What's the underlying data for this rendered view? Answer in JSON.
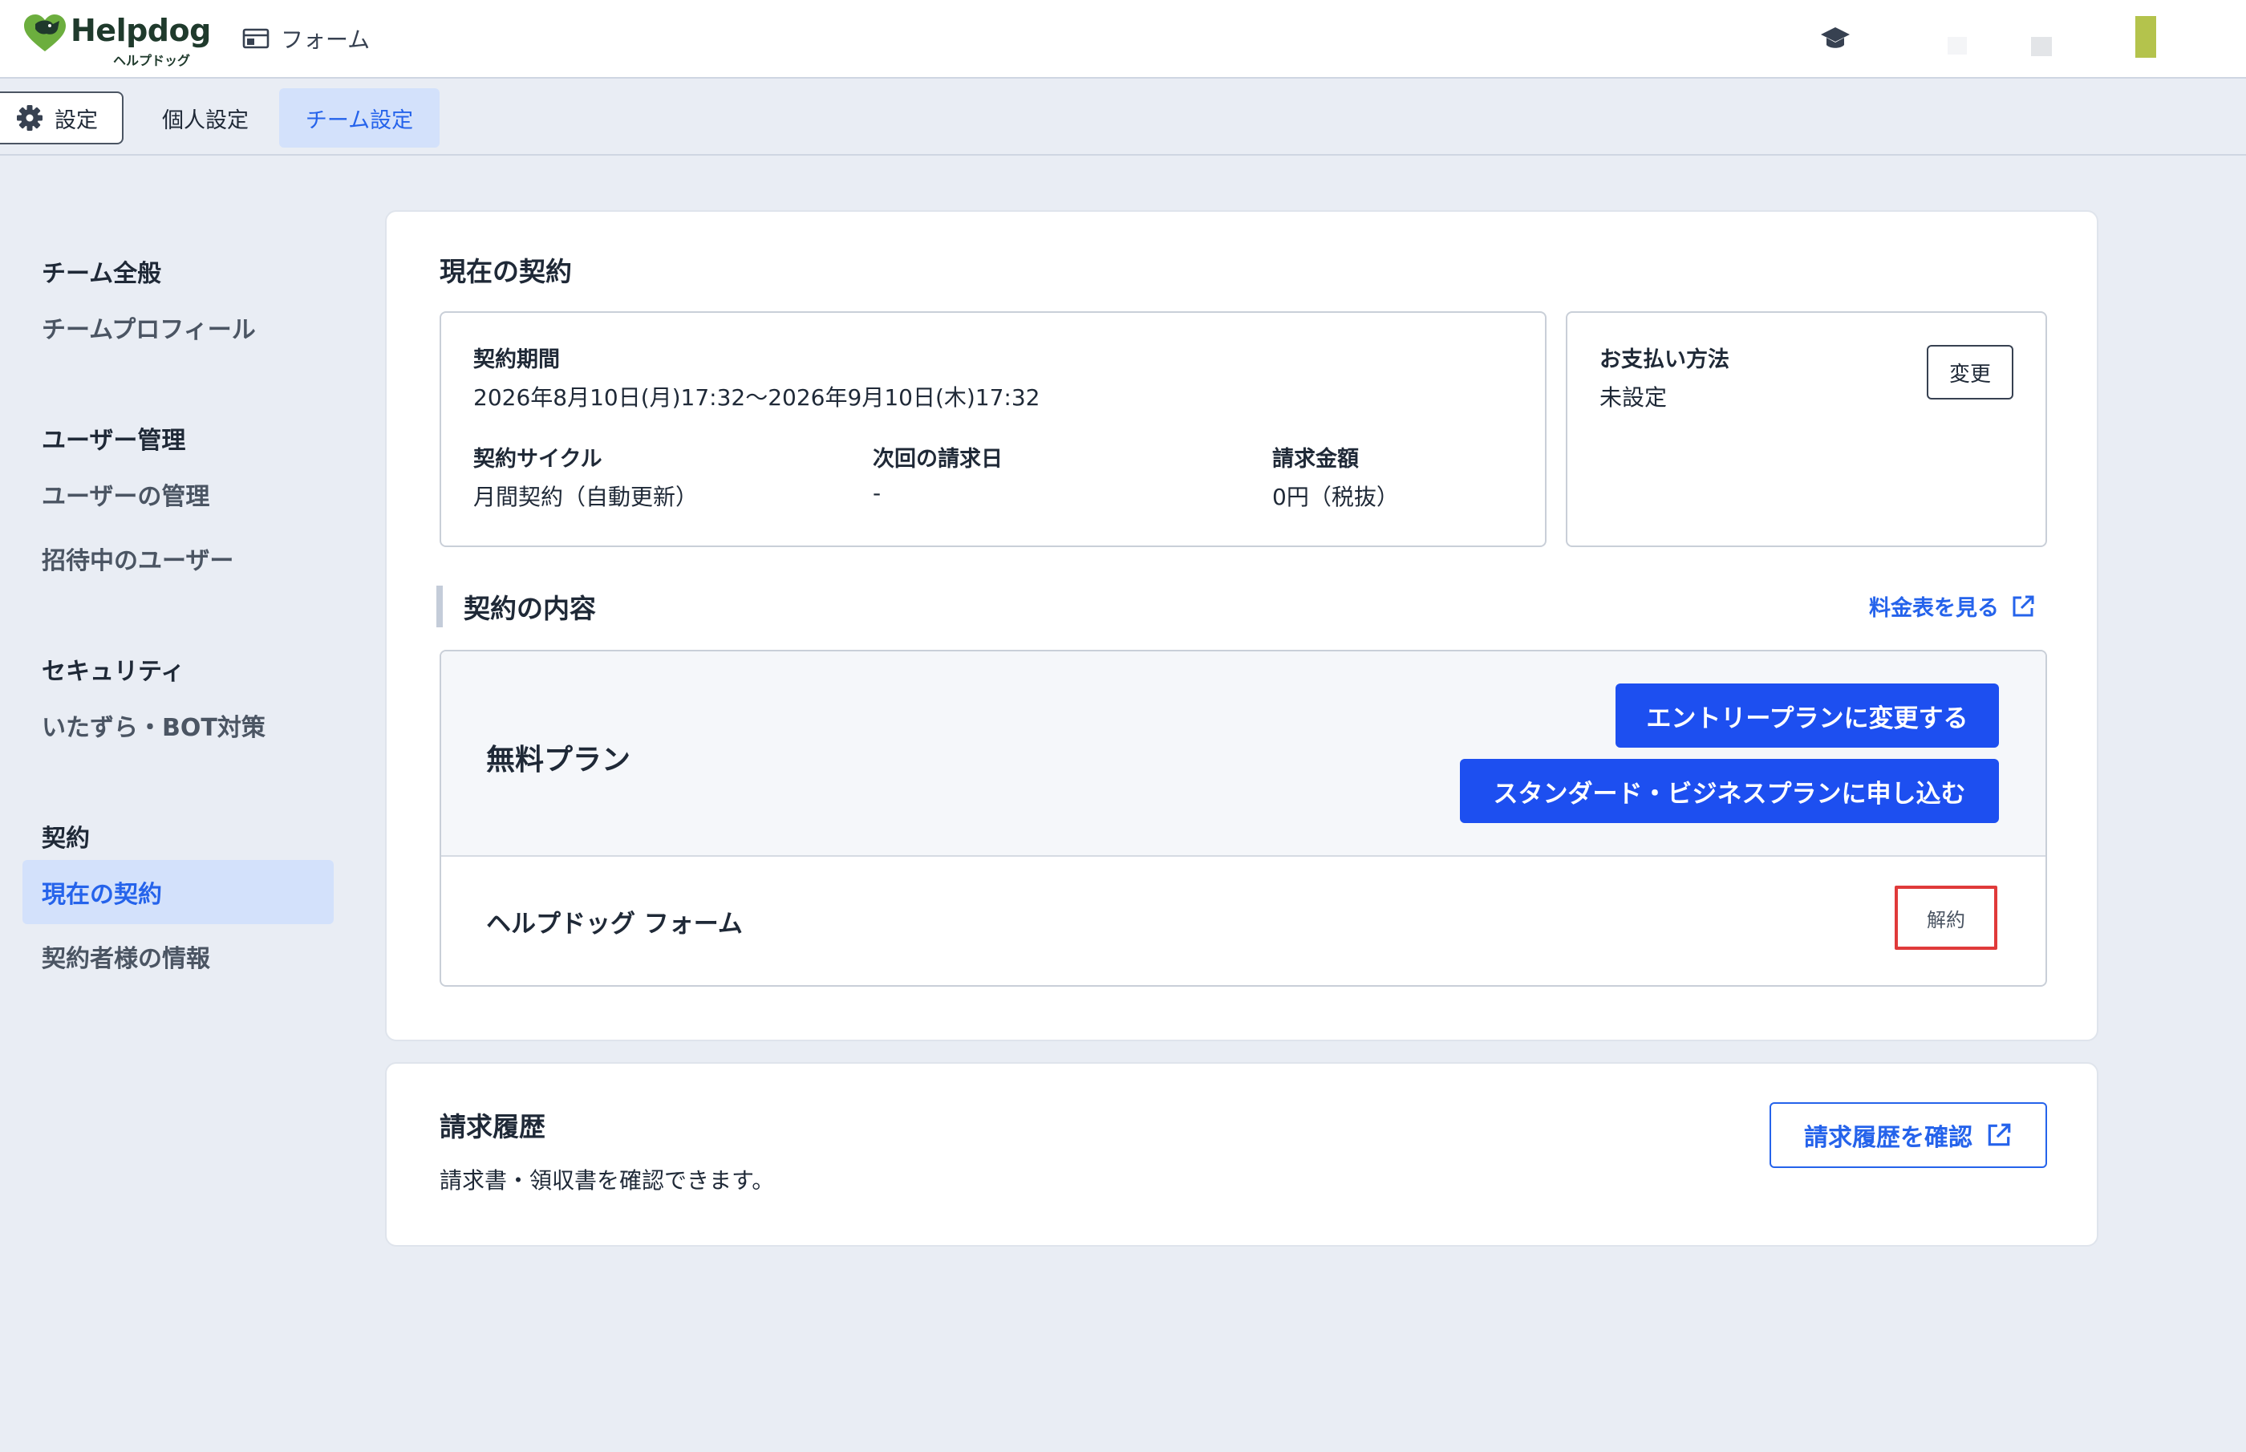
{
  "header": {
    "logo_name": "Helpdog",
    "logo_sub": "ヘルプドッグ",
    "form_label": "フォーム"
  },
  "tabs": {
    "settings": "設定",
    "personal": "個人設定",
    "team": "チーム設定"
  },
  "sidebar": {
    "groups": [
      {
        "heading": "チーム全般",
        "items": [
          "チームプロフィール"
        ]
      },
      {
        "heading": "ユーザー管理",
        "items": [
          "ユーザーの管理",
          "招待中のユーザー"
        ]
      },
      {
        "heading": "セキュリティ",
        "items": [
          "いたずら・BOT対策"
        ]
      },
      {
        "heading": "契約",
        "items": [
          "現在の契約",
          "契約者様の情報"
        ]
      }
    ],
    "active_item": "現在の契約"
  },
  "contract": {
    "title": "現在の契約",
    "period_label": "契約期間",
    "period_value": "2026年8月10日(月)17:32〜2026年9月10日(木)17:32",
    "cycle_label": "契約サイクル",
    "cycle_value": "月間契約（自動更新）",
    "next_billing_label": "次回の請求日",
    "next_billing_value": "-",
    "amount_label": "請求金額",
    "amount_value": "0円（税抜）",
    "payment_label": "お支払い方法",
    "payment_value": "未設定",
    "change_button": "変更"
  },
  "contents": {
    "title": "契約の内容",
    "pricing_link": "料金表を見る",
    "plan_name": "無料プラン",
    "entry_button": "エントリープランに変更する",
    "standard_button": "スタンダード・ビジネスプランに申し込む",
    "product_name": "ヘルプドッグ フォーム",
    "cancel_button": "解約"
  },
  "billing": {
    "title": "請求履歴",
    "description": "請求書・領収書を確認できます。",
    "button": "請求履歴を確認"
  },
  "colors": {
    "accent": "#1d4ff0",
    "link": "#2563eb",
    "active_bg": "#d3e1fb",
    "page_bg": "#e9edf4",
    "highlight_border": "#e03a3a"
  }
}
